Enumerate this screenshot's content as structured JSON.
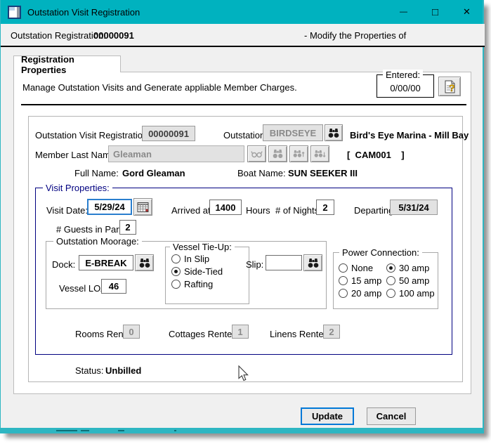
{
  "colors": {
    "titlebar": "#00b2bf",
    "focus_border": "#2a7ece",
    "default_button_border": "#0078d7",
    "group_border_navy": "#000080"
  },
  "window": {
    "title": "Outstation Visit Registration",
    "minimize_glyph": "—",
    "maximize_glyph": "□",
    "close_glyph": "✕"
  },
  "header": {
    "label": "Outstation Registration:",
    "registration_number": "00000091",
    "modify_text": "- Modify the Properties of"
  },
  "tab": {
    "label": "Registration Properties"
  },
  "intro": {
    "description": "Manage Outstation Visits and Generate appliable Member Charges.",
    "entered_label": "Entered:",
    "entered_value": "0/00/00"
  },
  "form": {
    "registration_id_label": "Outstation Visit Registration ID:",
    "registration_id_value": "00000091",
    "outstation_label": "Outstation:",
    "outstation_code": "BIRDSEYE",
    "outstation_name": "Bird's Eye Marina - Mill Bay",
    "member_last_name_label": "Member Last Name:",
    "member_last_name_value": "Gleaman",
    "member_code": "[  CAM001    ]",
    "full_name_label": "Full Name:",
    "full_name_value": "Gord Gleaman",
    "boat_name_label": "Boat Name:",
    "boat_name_value": "SUN SEEKER III"
  },
  "visit_properties": {
    "title": "Visit Properties:",
    "visit_date_label": "Visit Date:",
    "visit_date_value": "5/29/24",
    "arrived_label": "Arrived at:",
    "arrived_value": "1400",
    "arrived_suffix": "Hours",
    "nights_label": "# of Nights:",
    "nights_value": "2",
    "departing_label": "Departing:",
    "departing_value": "5/31/24",
    "guests_label": "# Guests in Party:",
    "guests_value": "2",
    "moorage": {
      "title": "Outstation Moorage:",
      "dock_label": "Dock:",
      "dock_value": "E-BREAK",
      "vessel_loa_label": "Vessel LOA:",
      "vessel_loa_value": "46",
      "tie_up": {
        "title": "Vessel Tie-Up:",
        "options": [
          "In Slip",
          "Side-Tied",
          "Rafting"
        ],
        "selected": "Side-Tied"
      },
      "slip_label": "Slip:",
      "slip_value": "",
      "power": {
        "title": "Power Connection:",
        "options": [
          "None",
          "15 amp",
          "20 amp",
          "30 amp",
          "50 amp",
          "100 amp"
        ],
        "selected": "30 amp"
      }
    },
    "rooms_label": "Rooms Rented:",
    "rooms_value": "0",
    "cottages_label": "Cottages Rented:",
    "cottages_value": "1",
    "linens_label": "Linens Rented:",
    "linens_value": "2"
  },
  "status": {
    "label": "Status:",
    "value": "Unbilled"
  },
  "buttons": {
    "update": "Update",
    "cancel": "Cancel"
  }
}
